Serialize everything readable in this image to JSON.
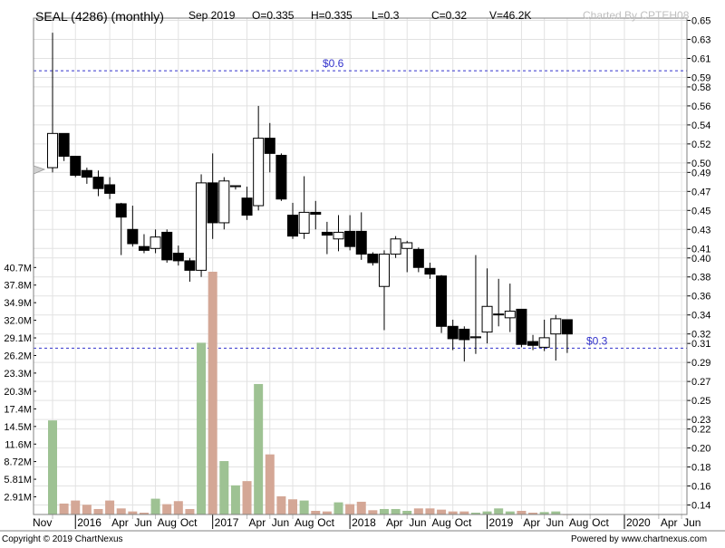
{
  "header": {
    "title": "SEAL (4286) (monthly)",
    "period": "Sep 2019",
    "open": "O=0.335",
    "high": "H=0.335",
    "low": "L=0.3",
    "close": "C=0.32",
    "volume": "V=46.2K",
    "charted_by": "Charted By CPTEH08"
  },
  "footer": {
    "copyright": "Copyright © 2019 ChartNexus",
    "powered_by": "Powered by www.chartnexus.com"
  },
  "colors": {
    "up_candle": "#ffffff",
    "down_candle": "#000000",
    "volume_up": "#9ec293",
    "volume_down": "#d4a796",
    "reference_line": "#3333cc",
    "grid": "#e2e2e2"
  },
  "chart_data": {
    "type": "candlestick",
    "price_axis": {
      "range": [
        0.12,
        0.65
      ],
      "ticks": [
        "0.65",
        "0.63",
        "0.61",
        "0.59",
        "0.58",
        "0.56",
        "0.54",
        "0.52",
        "0.50",
        "0.49",
        "0.47",
        "0.45",
        "0.43",
        "0.41",
        "0.40",
        "0.38",
        "0.36",
        "0.34",
        "0.32",
        "0.31",
        "0.29",
        "0.27",
        "0.25",
        "0.23",
        "0.22",
        "0.20",
        "0.18",
        "0.16",
        "0.14"
      ]
    },
    "volume_axis": {
      "ticks": [
        "40.7M",
        "37.8M",
        "34.9M",
        "32.0M",
        "29.1M",
        "26.2M",
        "23.3M",
        "20.3M",
        "17.4M",
        "14.5M",
        "11.6M",
        "8.72M",
        "5.81M",
        "2.91M"
      ]
    },
    "x_labels": [
      "Nov",
      "2016",
      "Apr",
      "Jun",
      "Aug",
      "Oct",
      "2017",
      "Apr",
      "Jun",
      "Aug",
      "Oct",
      "2018",
      "Apr",
      "Jun",
      "Aug",
      "Oct",
      "2019",
      "Apr",
      "Jun",
      "Aug",
      "Oct",
      "2020",
      "Apr",
      "Jun"
    ],
    "reference_lines": [
      {
        "label": "$0.6",
        "value": 0.597
      },
      {
        "label": "$0.3",
        "value": 0.305
      }
    ],
    "candles": [
      {
        "month": "2015-11",
        "open": 0.495,
        "high": 0.637,
        "low": 0.49,
        "close": 0.531,
        "volume": 15.5
      },
      {
        "month": "2015-12",
        "open": 0.531,
        "high": 0.531,
        "low": 0.502,
        "close": 0.507,
        "volume": 1.8
      },
      {
        "month": "2016-01",
        "open": 0.507,
        "high": 0.507,
        "low": 0.485,
        "close": 0.487,
        "volume": 2.3
      },
      {
        "month": "2016-02",
        "open": 0.492,
        "high": 0.495,
        "low": 0.478,
        "close": 0.485,
        "volume": 1.6
      },
      {
        "month": "2016-03",
        "open": 0.485,
        "high": 0.492,
        "low": 0.465,
        "close": 0.473,
        "volume": 0.9
      },
      {
        "month": "2016-04",
        "open": 0.477,
        "high": 0.485,
        "low": 0.462,
        "close": 0.468,
        "volume": 2.3
      },
      {
        "month": "2016-05",
        "open": 0.457,
        "high": 0.458,
        "low": 0.403,
        "close": 0.443,
        "volume": 1.0
      },
      {
        "month": "2016-06",
        "open": 0.43,
        "high": 0.455,
        "low": 0.412,
        "close": 0.415,
        "volume": 0.5
      },
      {
        "month": "2016-07",
        "open": 0.412,
        "high": 0.425,
        "low": 0.405,
        "close": 0.408,
        "volume": 0.3
      },
      {
        "month": "2016-08",
        "open": 0.41,
        "high": 0.43,
        "low": 0.405,
        "close": 0.422,
        "volume": 2.6
      },
      {
        "month": "2016-09",
        "open": 0.427,
        "high": 0.43,
        "low": 0.395,
        "close": 0.398,
        "volume": 1.7
      },
      {
        "month": "2016-10",
        "open": 0.405,
        "high": 0.413,
        "low": 0.392,
        "close": 0.397,
        "volume": 2.2
      },
      {
        "month": "2016-11",
        "open": 0.397,
        "high": 0.4,
        "low": 0.375,
        "close": 0.387,
        "volume": 0.9
      },
      {
        "month": "2016-12",
        "open": 0.387,
        "high": 0.488,
        "low": 0.38,
        "close": 0.479,
        "volume": 28.3
      },
      {
        "month": "2017-01",
        "open": 0.479,
        "high": 0.51,
        "low": 0.42,
        "close": 0.437,
        "volume": 40.0
      },
      {
        "month": "2017-02",
        "open": 0.437,
        "high": 0.485,
        "low": 0.43,
        "close": 0.481,
        "volume": 8.8
      },
      {
        "month": "2017-03",
        "open": 0.475,
        "high": 0.476,
        "low": 0.472,
        "close": 0.476,
        "volume": 4.8
      },
      {
        "month": "2017-04",
        "open": 0.463,
        "high": 0.475,
        "low": 0.44,
        "close": 0.445,
        "volume": 5.5
      },
      {
        "month": "2017-05",
        "open": 0.455,
        "high": 0.56,
        "low": 0.45,
        "close": 0.526,
        "volume": 21.5
      },
      {
        "month": "2017-06",
        "open": 0.526,
        "high": 0.542,
        "low": 0.49,
        "close": 0.51,
        "volume": 9.9
      },
      {
        "month": "2017-07",
        "open": 0.508,
        "high": 0.51,
        "low": 0.46,
        "close": 0.462,
        "volume": 3.0
      },
      {
        "month": "2017-08",
        "open": 0.445,
        "high": 0.458,
        "low": 0.42,
        "close": 0.423,
        "volume": 2.5
      },
      {
        "month": "2017-09",
        "open": 0.426,
        "high": 0.486,
        "low": 0.42,
        "close": 0.448,
        "volume": 2.3
      },
      {
        "month": "2017-10",
        "open": 0.448,
        "high": 0.46,
        "low": 0.43,
        "close": 0.446,
        "volume": 0.6
      },
      {
        "month": "2017-11",
        "open": 0.427,
        "high": 0.438,
        "low": 0.404,
        "close": 0.424,
        "volume": 0.5
      },
      {
        "month": "2017-12",
        "open": 0.42,
        "high": 0.445,
        "low": 0.407,
        "close": 0.427,
        "volume": 2.0
      },
      {
        "month": "2018-01",
        "open": 0.428,
        "high": 0.445,
        "low": 0.408,
        "close": 0.412,
        "volume": 1.7
      },
      {
        "month": "2018-02",
        "open": 0.428,
        "high": 0.448,
        "low": 0.398,
        "close": 0.404,
        "volume": 2.1
      },
      {
        "month": "2018-03",
        "open": 0.404,
        "high": 0.406,
        "low": 0.392,
        "close": 0.395,
        "volume": 0.7
      },
      {
        "month": "2018-04",
        "open": 0.37,
        "high": 0.408,
        "low": 0.324,
        "close": 0.404,
        "volume": 0.9
      },
      {
        "month": "2018-05",
        "open": 0.404,
        "high": 0.423,
        "low": 0.4,
        "close": 0.42,
        "volume": 0.9
      },
      {
        "month": "2018-06",
        "open": 0.41,
        "high": 0.418,
        "low": 0.385,
        "close": 0.416,
        "volume": 0.6
      },
      {
        "month": "2018-07",
        "open": 0.409,
        "high": 0.411,
        "low": 0.385,
        "close": 0.39,
        "volume": 1.0
      },
      {
        "month": "2018-08",
        "open": 0.389,
        "high": 0.395,
        "low": 0.378,
        "close": 0.383,
        "volume": 1.0
      },
      {
        "month": "2018-09",
        "open": 0.381,
        "high": 0.382,
        "low": 0.321,
        "close": 0.328,
        "volume": 0.8
      },
      {
        "month": "2018-10",
        "open": 0.328,
        "high": 0.335,
        "low": 0.303,
        "close": 0.315,
        "volume": 0.5
      },
      {
        "month": "2018-11",
        "open": 0.325,
        "high": 0.328,
        "low": 0.291,
        "close": 0.314,
        "volume": 0.5
      },
      {
        "month": "2018-12",
        "open": 0.316,
        "high": 0.403,
        "low": 0.299,
        "close": 0.317,
        "volume": 0.3
      },
      {
        "month": "2019-01",
        "open": 0.322,
        "high": 0.389,
        "low": 0.31,
        "close": 0.349,
        "volume": 0.5
      },
      {
        "month": "2019-02",
        "open": 0.341,
        "high": 0.378,
        "low": 0.328,
        "close": 0.341,
        "volume": 1.0
      },
      {
        "month": "2019-03",
        "open": 0.337,
        "high": 0.373,
        "low": 0.322,
        "close": 0.344,
        "volume": 0.5
      },
      {
        "month": "2019-04",
        "open": 0.346,
        "high": 0.346,
        "low": 0.306,
        "close": 0.309,
        "volume": 0.6
      },
      {
        "month": "2019-05",
        "open": 0.312,
        "high": 0.319,
        "low": 0.303,
        "close": 0.308,
        "volume": 0.3
      },
      {
        "month": "2019-06",
        "open": 0.306,
        "high": 0.335,
        "low": 0.302,
        "close": 0.316,
        "volume": 0.4
      },
      {
        "month": "2019-07",
        "open": 0.32,
        "high": 0.34,
        "low": 0.292,
        "close": 0.336,
        "volume": 0.5
      },
      {
        "month": "2019-08",
        "open": 0.335,
        "high": 0.335,
        "low": 0.3,
        "close": 0.32,
        "volume": 0.05
      }
    ]
  }
}
